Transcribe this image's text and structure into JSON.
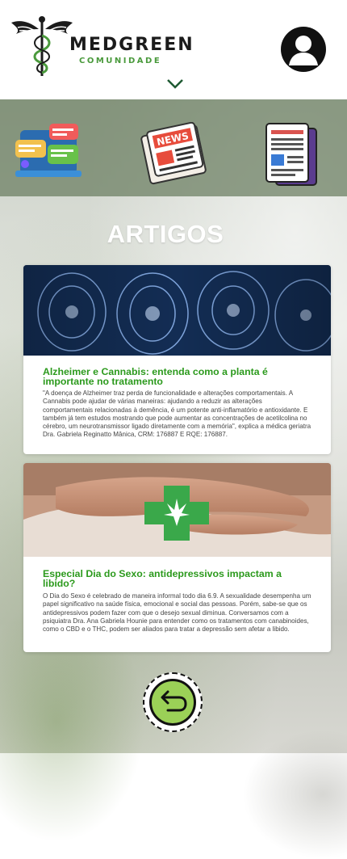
{
  "header": {
    "logo_title": "MEDGREEN",
    "logo_subtitle": "COMUNIDADE",
    "avatar_icon": "user-avatar-icon",
    "expand_icon": "chevron-down-icon"
  },
  "categories": [
    {
      "icon": "chat-bubbles-icon"
    },
    {
      "icon": "newspaper-icon"
    },
    {
      "icon": "document-icon"
    }
  ],
  "page": {
    "heading": "ARTIGOS"
  },
  "articles": [
    {
      "title": "Alzheimer e Cannabis: entenda como a planta é importante no tratamento",
      "excerpt": "\"A doença de Alzheimer traz perda de funcionalidade e alterações comportamentais. A Cannabis pode ajudar de várias maneiras: ajudando a reduzir as alterações comportamentais relacionadas à demência, é um potente anti-inflamatório e antioxidante. E também já tem estudos mostrando que pode aumentar as concentrações de acetilcolina no cérebro, um neurotransmissor ligado diretamente com a memória\", explica a médica geriatra Dra. Gabriela Reginatto Mânica, CRM: 176887 E RQE: 176887."
    },
    {
      "title": "Especial Dia do Sexo: antidepressivos impactam a libido?",
      "excerpt": "O Dia do Sexo é celebrado de maneira informal todo dia 6.9. A sexualidade desempenha um papel significativo na saúde física, emocional e social das pessoas. Porém, sabe-se que os antidepressivos podem  fazer com que o desejo sexual diminua. Conversamos com a psiquiatra Dra. Ana Gabriela Hounie para entender como os tratamentos com canabinoides, como o CBD e o THC, podem ser aliados para tratar a depressão sem afetar a libido."
    }
  ],
  "footer": {
    "back_icon": "return-arrow-icon"
  },
  "colors": {
    "accent_green": "#2c9a1d",
    "logo_green": "#4a9a3c",
    "button_green": "#9bd157"
  }
}
